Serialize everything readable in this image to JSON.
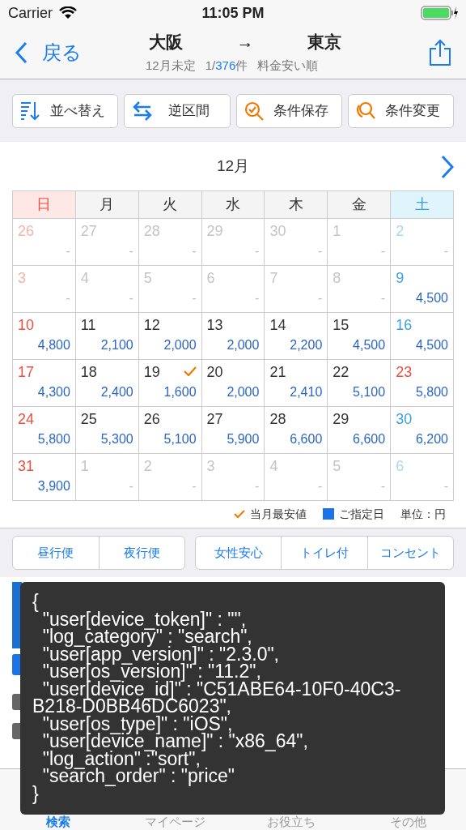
{
  "status_bar": {
    "carrier": "Carrier",
    "time": "11:05 PM"
  },
  "nav": {
    "back": "戻る",
    "from": "大阪",
    "arrow": "→",
    "to": "東京",
    "date": "12月未定",
    "count_prefix": "1/",
    "count_total": "376",
    "count_suffix": "件",
    "order": "料金安い順"
  },
  "toolbar": [
    {
      "kind": "sort",
      "label": "並べ替え"
    },
    {
      "kind": "swap",
      "label": "逆区間"
    },
    {
      "kind": "save",
      "label": "条件保存"
    },
    {
      "kind": "change",
      "label": "条件変更"
    }
  ],
  "calendar": {
    "month": "12月",
    "weekdays": [
      {
        "label": "日",
        "kind": "sun"
      },
      {
        "label": "月",
        "kind": "weekday"
      },
      {
        "label": "火",
        "kind": "weekday"
      },
      {
        "label": "水",
        "kind": "weekday"
      },
      {
        "label": "木",
        "kind": "weekday"
      },
      {
        "label": "金",
        "kind": "weekday"
      },
      {
        "label": "土",
        "kind": "sat"
      }
    ],
    "weeks": [
      [
        {
          "day": "26",
          "price": "-",
          "kind": "sun",
          "available": false
        },
        {
          "day": "27",
          "price": "-",
          "kind": "weekday",
          "available": false
        },
        {
          "day": "28",
          "price": "-",
          "kind": "weekday",
          "available": false
        },
        {
          "day": "29",
          "price": "-",
          "kind": "weekday",
          "available": false
        },
        {
          "day": "30",
          "price": "-",
          "kind": "weekday",
          "available": false
        },
        {
          "day": "1",
          "price": "-",
          "kind": "weekday",
          "available": false
        },
        {
          "day": "2",
          "price": "-",
          "kind": "sat",
          "available": false
        }
      ],
      [
        {
          "day": "3",
          "price": "-",
          "kind": "sun",
          "available": false
        },
        {
          "day": "4",
          "price": "-",
          "kind": "weekday",
          "available": false
        },
        {
          "day": "5",
          "price": "-",
          "kind": "weekday",
          "available": false
        },
        {
          "day": "6",
          "price": "-",
          "kind": "weekday",
          "available": false
        },
        {
          "day": "7",
          "price": "-",
          "kind": "weekday",
          "available": false
        },
        {
          "day": "8",
          "price": "-",
          "kind": "weekday",
          "available": false
        },
        {
          "day": "9",
          "price": "4,500",
          "kind": "sat",
          "available": true
        }
      ],
      [
        {
          "day": "10",
          "price": "4,800",
          "kind": "sun",
          "available": true
        },
        {
          "day": "11",
          "price": "2,100",
          "kind": "weekday",
          "available": true
        },
        {
          "day": "12",
          "price": "2,000",
          "kind": "weekday",
          "available": true
        },
        {
          "day": "13",
          "price": "2,000",
          "kind": "weekday",
          "available": true
        },
        {
          "day": "14",
          "price": "2,200",
          "kind": "weekday",
          "available": true
        },
        {
          "day": "15",
          "price": "4,500",
          "kind": "weekday",
          "available": true
        },
        {
          "day": "16",
          "price": "4,500",
          "kind": "sat",
          "available": true
        }
      ],
      [
        {
          "day": "17",
          "price": "4,300",
          "kind": "sun",
          "available": true
        },
        {
          "day": "18",
          "price": "2,400",
          "kind": "weekday",
          "available": true
        },
        {
          "day": "19",
          "price": "1,600",
          "kind": "weekday",
          "available": true,
          "lowest": true
        },
        {
          "day": "20",
          "price": "2,000",
          "kind": "weekday",
          "available": true
        },
        {
          "day": "21",
          "price": "2,410",
          "kind": "weekday",
          "available": true
        },
        {
          "day": "22",
          "price": "5,100",
          "kind": "weekday",
          "available": true
        },
        {
          "day": "23",
          "price": "5,800",
          "kind": "holiday",
          "available": true
        }
      ],
      [
        {
          "day": "24",
          "price": "5,800",
          "kind": "sun",
          "available": true
        },
        {
          "day": "25",
          "price": "5,300",
          "kind": "weekday",
          "available": true
        },
        {
          "day": "26",
          "price": "5,100",
          "kind": "weekday",
          "available": true
        },
        {
          "day": "27",
          "price": "5,900",
          "kind": "weekday",
          "available": true
        },
        {
          "day": "28",
          "price": "6,600",
          "kind": "weekday",
          "available": true
        },
        {
          "day": "29",
          "price": "6,600",
          "kind": "weekday",
          "available": true
        },
        {
          "day": "30",
          "price": "6,200",
          "kind": "sat",
          "available": true
        }
      ],
      [
        {
          "day": "31",
          "price": "3,900",
          "kind": "sun",
          "available": true
        },
        {
          "day": "1",
          "price": "-",
          "kind": "weekday",
          "available": false
        },
        {
          "day": "2",
          "price": "-",
          "kind": "weekday",
          "available": false
        },
        {
          "day": "3",
          "price": "-",
          "kind": "weekday",
          "available": false
        },
        {
          "day": "4",
          "price": "-",
          "kind": "weekday",
          "available": false
        },
        {
          "day": "5",
          "price": "-",
          "kind": "weekday",
          "available": false
        },
        {
          "day": "6",
          "price": "-",
          "kind": "sat",
          "available": false
        }
      ]
    ],
    "legend": {
      "lowest": "当月最安値",
      "selected": "ご指定日",
      "unit": "単位：円"
    }
  },
  "filters": [
    [
      "昼行便",
      "夜行便"
    ],
    [
      "女性安心",
      "トイレ付",
      "コンセント"
    ]
  ],
  "debug_overlay": {
    "lines": [
      "{",
      "  \"user[device_token]\" : \"\",",
      "  \"log_category\" : \"search\",",
      "  \"user[app_version]\" : \"2.3.0\",",
      "  \"user[os_version]\" : \"11.2\",",
      "  \"user[device_id]\" : \"C51ABE64-10F0-40C3-B218-D0BB46DC6023\",",
      "  \"user[os_type]\" : \"iOS\",",
      "  \"user[device_name]\" : \"x86_64\",",
      "  \"log_action\" :\"sort\",",
      "  \"search_order\" : \"price\"",
      "}"
    ]
  },
  "tab_bar": [
    {
      "label": "検索",
      "selected": true
    },
    {
      "label": "マイページ",
      "selected": false
    },
    {
      "label": "お役立ち",
      "selected": false
    },
    {
      "label": "その他",
      "selected": false
    }
  ]
}
